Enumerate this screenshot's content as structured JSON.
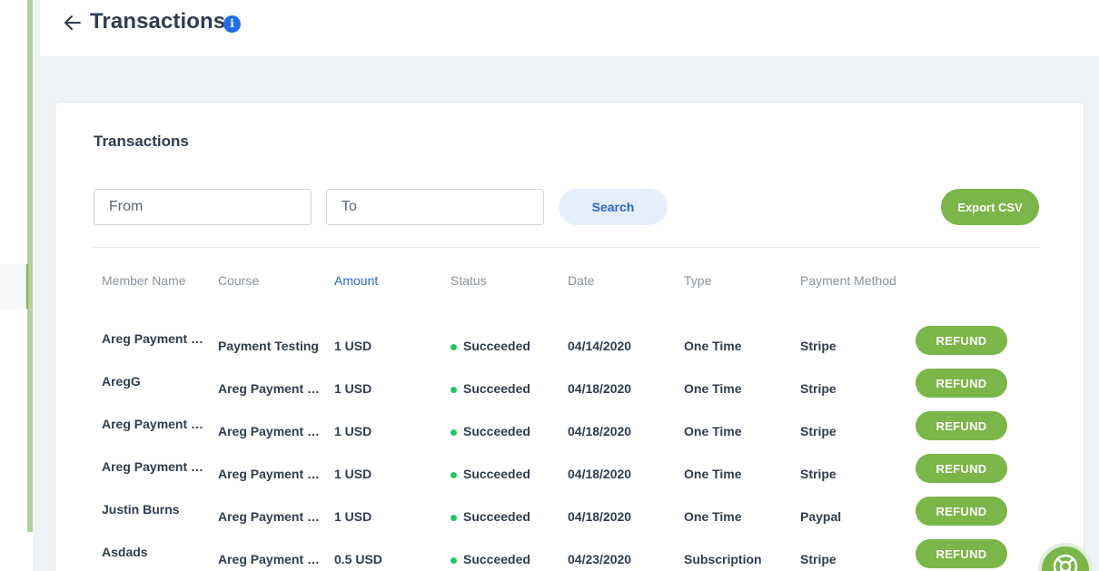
{
  "page": {
    "title": "Transactions"
  },
  "card": {
    "title": "Transactions",
    "from_placeholder": "From",
    "to_placeholder": "To",
    "search_label": "Search",
    "export_label": "Export CSV"
  },
  "table": {
    "columns": [
      "Member Name",
      "Course",
      "Amount",
      "Status",
      "Date",
      "Type",
      "Payment Method"
    ],
    "sorted_column": "Amount",
    "refund_label": "REFUND",
    "rows": [
      {
        "member": "Areg Payment Testing",
        "course": "Payment Testing",
        "amount": "1 USD",
        "status": "Succeeded",
        "date": "04/14/2020",
        "type": "One Time",
        "method": "Stripe"
      },
      {
        "member": "AregG",
        "course": "Areg Payment Testing",
        "amount": "1 USD",
        "status": "Succeeded",
        "date": "04/18/2020",
        "type": "One Time",
        "method": "Stripe"
      },
      {
        "member": "Areg Payment Testing",
        "course": "Areg Payment Testing",
        "amount": "1 USD",
        "status": "Succeeded",
        "date": "04/18/2020",
        "type": "One Time",
        "method": "Stripe"
      },
      {
        "member": "Areg Payment Testing",
        "course": "Areg Payment Testing",
        "amount": "1 USD",
        "status": "Succeeded",
        "date": "04/18/2020",
        "type": "One Time",
        "method": "Stripe"
      },
      {
        "member": "Justin Burns",
        "course": "Areg Payment Testing",
        "amount": "1 USD",
        "status": "Succeeded",
        "date": "04/18/2020",
        "type": "One Time",
        "method": "Paypal"
      },
      {
        "member": "Asdads",
        "course": "Areg Payment Testing",
        "amount": "0.5 USD",
        "status": "Succeeded",
        "date": "04/23/2020",
        "type": "Subscription",
        "method": "Stripe"
      }
    ]
  },
  "colors": {
    "accent_green": "#7ab648",
    "link_blue": "#2867d5",
    "status_green": "#22c55e"
  }
}
